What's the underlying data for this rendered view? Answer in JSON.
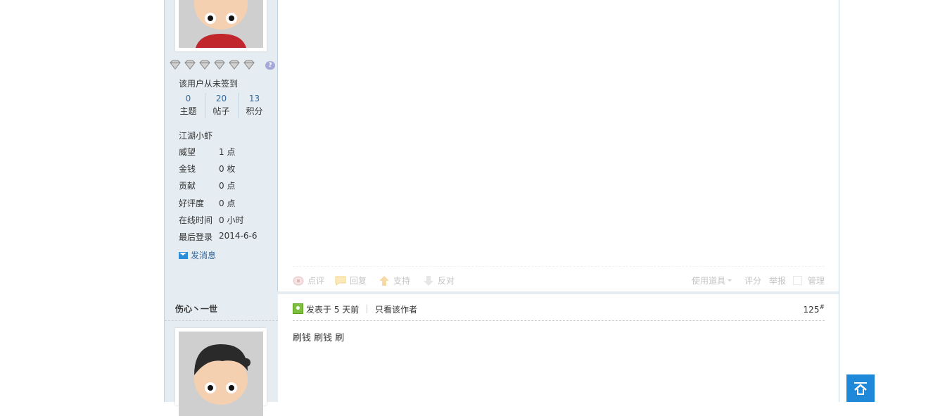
{
  "post1": {
    "signin_text": "该用户从未签到",
    "stats": [
      {
        "value": "0",
        "label": "主题"
      },
      {
        "value": "20",
        "label": "帖子"
      },
      {
        "value": "13",
        "label": "积分"
      }
    ],
    "level": "江湖小虾",
    "profile": [
      {
        "key": "威望",
        "value": "1 点"
      },
      {
        "key": "金钱",
        "value": "0 枚"
      },
      {
        "key": "贡献",
        "value": "0 点"
      },
      {
        "key": "好评度",
        "value": "0 点"
      },
      {
        "key": "在线时间",
        "value": "0 小时"
      },
      {
        "key": "最后登录",
        "value": "2014-6-6"
      }
    ],
    "send_message": "发消息",
    "actions": {
      "comment": "点评",
      "reply": "回复",
      "support": "支持",
      "oppose": "反对",
      "use_tool": "使用道具",
      "rate": "评分",
      "report": "举报",
      "manage": "管理"
    }
  },
  "post2": {
    "author": "伤心丶一世",
    "posted": "发表于 5 天前",
    "only_author": "只看该作者",
    "floor": "125",
    "floor_mark": "#",
    "content": "刷钱 刷钱 刷"
  },
  "colors": {
    "sidebar_bg": "#e5edf2",
    "border": "#c2d5e3",
    "link": "#336699",
    "back_to_top": "#1e88d9"
  },
  "icons": [
    "diamond-medal-icon",
    "help-question-icon",
    "envelope-icon",
    "comment-icon",
    "reply-icon",
    "support-arrow-up-icon",
    "oppose-arrow-down-icon",
    "user-post-icon",
    "back-to-top-icon"
  ]
}
